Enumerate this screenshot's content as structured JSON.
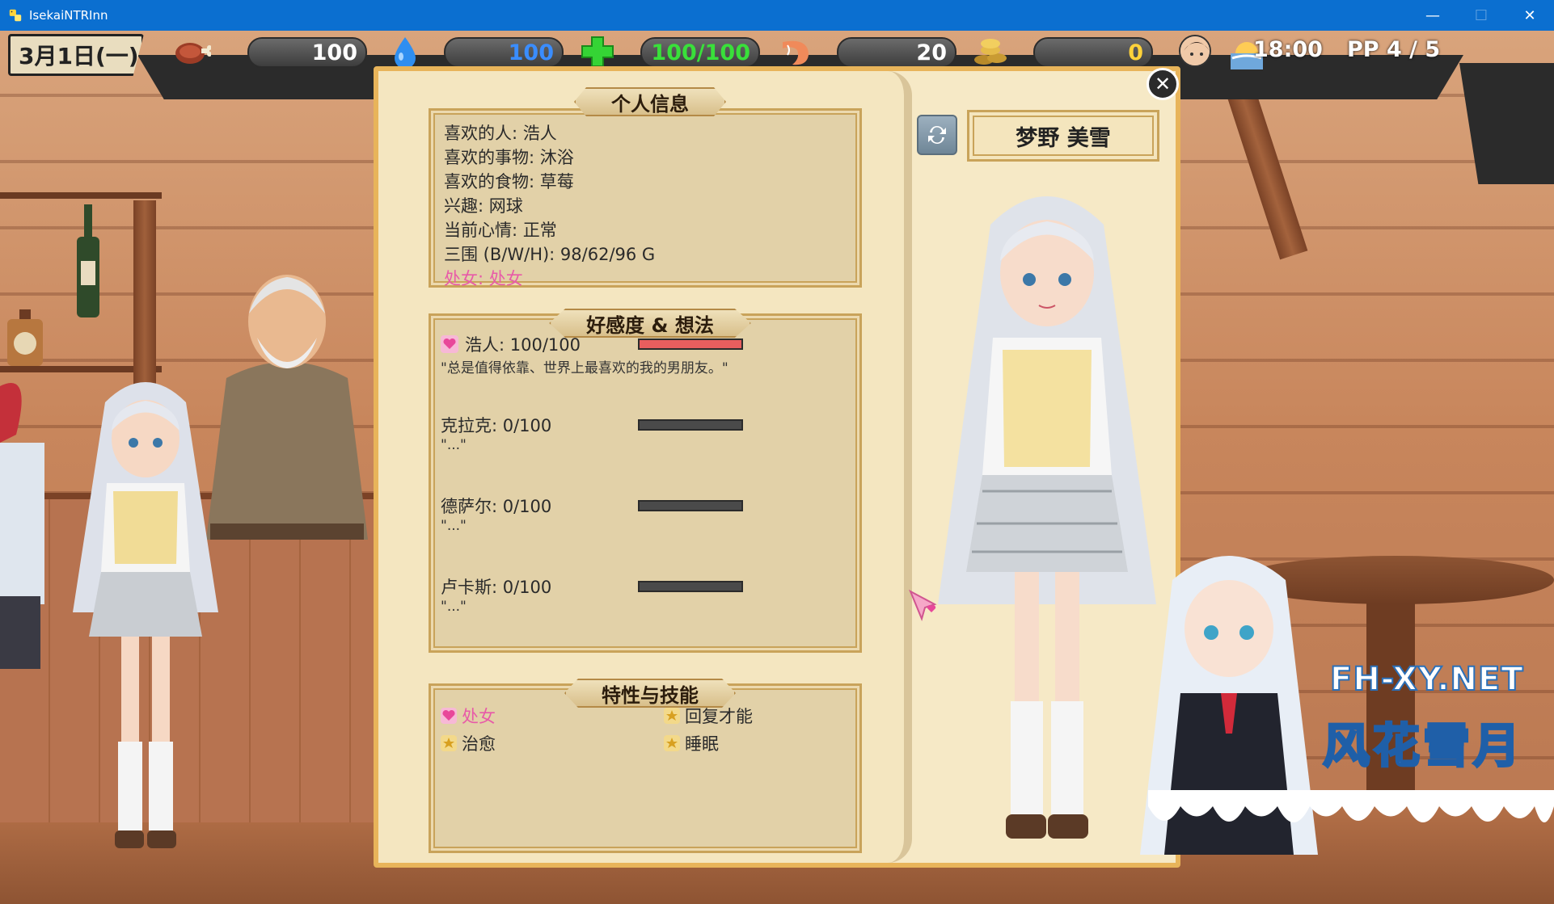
{
  "window": {
    "title": "IsekaiNTRInn",
    "minimize": "—",
    "maximize": "☐",
    "close": "✕"
  },
  "hud": {
    "date": "3月1日(一)",
    "food": "100",
    "water": "100",
    "health": "100/100",
    "shrimp": "20",
    "gold": "0",
    "time": "18:00",
    "pp": "PP 4 / 5",
    "colors": {
      "water": "#3a8dff",
      "health": "#39e03a",
      "default": "#ffffff",
      "gold": "#ffd23a"
    }
  },
  "personal_info": {
    "title": "个人信息",
    "lines": [
      "喜欢的人: 浩人",
      "喜欢的事物: 沐浴",
      "喜欢的食物: 草莓",
      "兴趣: 网球",
      "当前心情: 正常",
      "三围 (B/W/H): 98/62/96 G"
    ],
    "virgin_line": "处女: 处女"
  },
  "affection": {
    "title": "好感度 & 想法",
    "rows": [
      {
        "label": "浩人: 100/100",
        "value": 100,
        "max": 100,
        "quote": "\"总是值得依靠、世界上最喜欢的我的男朋友。\""
      },
      {
        "label": "克拉克: 0/100",
        "value": 0,
        "max": 100,
        "quote": "\"...\""
      },
      {
        "label": "德萨尔: 0/100",
        "value": 0,
        "max": 100,
        "quote": "\"...\""
      },
      {
        "label": "卢卡斯: 0/100",
        "value": 0,
        "max": 100,
        "quote": "\"...\""
      }
    ]
  },
  "traits": {
    "title": "特性与技能",
    "items": [
      "处女",
      "回复才能",
      "治愈",
      "睡眠"
    ]
  },
  "character": {
    "name": "梦野 美雪"
  },
  "watermark": {
    "line1": "FH-XY.NET",
    "line2": "风花雪月"
  }
}
